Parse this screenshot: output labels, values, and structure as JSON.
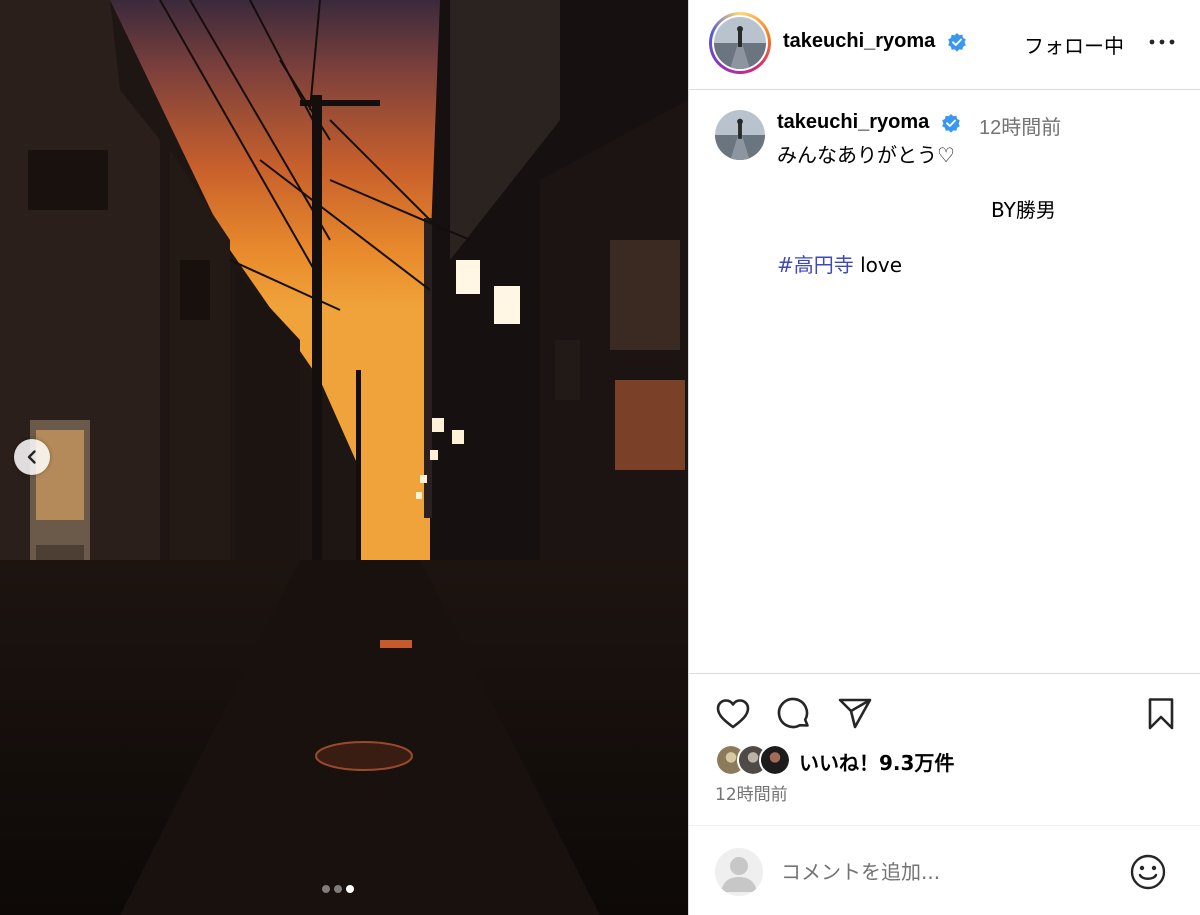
{
  "post": {
    "username": "takeuchi_ryoma",
    "follow_label": "フォロー中",
    "caption": {
      "username": "takeuchi_ryoma",
      "time": "12時間前",
      "line1": "みんなありがとう♡",
      "line2": "BY勝男",
      "hashtag": "#高円寺",
      "line3_rest": " love"
    },
    "likes_text": "いいね！9.3万件",
    "timestamp": "12時間前",
    "comment_placeholder": "コメントを追加..."
  },
  "carousel": {
    "slide_count": 3,
    "active_index": 2
  },
  "icons": {
    "prev": "chevron-left-icon",
    "verified": "verified-badge-icon",
    "more": "more-horizontal-icon",
    "like": "heart-icon",
    "comment": "comment-icon",
    "share": "send-icon",
    "save": "bookmark-icon",
    "emoji": "emoji-icon"
  },
  "colors": {
    "verified": "#3897f0",
    "hashtag": "#3f49b8",
    "secondary_text": "#737373",
    "divider": "#dbdbdb"
  }
}
